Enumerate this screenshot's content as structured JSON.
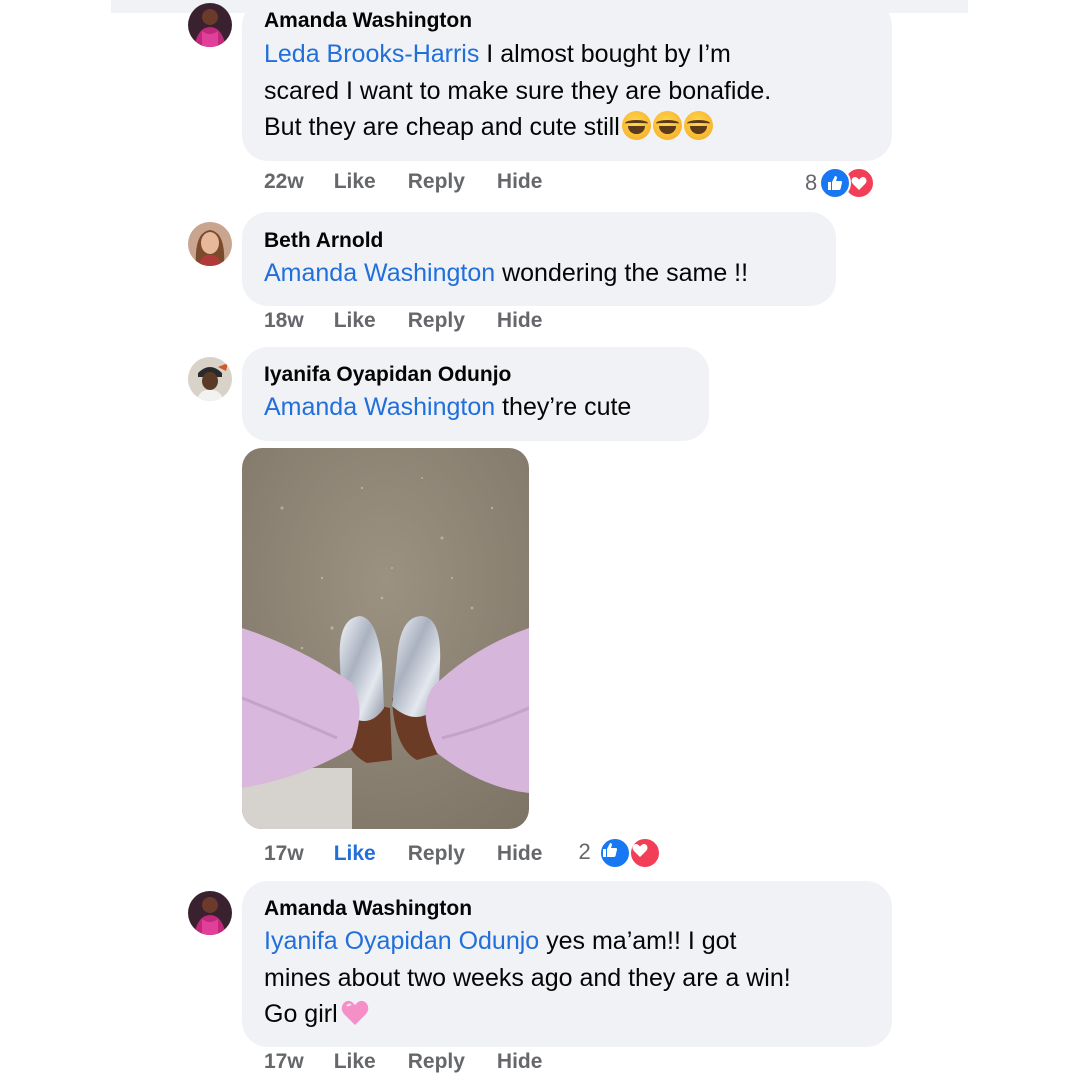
{
  "comments": [
    {
      "author": "Amanda Washington",
      "mention": "Leda Brooks-Harris",
      "lines": [
        " I almost bought by I’m",
        "scared I want to make sure they are bonafide.",
        "But they are cheap and cute still"
      ],
      "emoji": [
        "laughing-tears",
        "laughing-tears",
        "laughing-tears"
      ],
      "time": "22w",
      "like_label": "Like",
      "reply_label": "Reply",
      "hide_label": "Hide",
      "reaction_count": "8",
      "reactions": [
        "like",
        "love"
      ]
    },
    {
      "author": "Beth Arnold",
      "mention": "Amanda Washington",
      "text": " wondering the same !!",
      "time": "18w",
      "like_label": "Like",
      "reply_label": "Reply",
      "hide_label": "Hide"
    },
    {
      "author": "Iyanifa Oyapidan Odunjo",
      "mention": "Amanda Washington",
      "text": " they’re cute",
      "has_photo": true,
      "time": "17w",
      "like_label": "Like",
      "like_active": true,
      "reply_label": "Reply",
      "hide_label": "Hide",
      "reaction_count": "2",
      "reactions": [
        "like",
        "love"
      ]
    },
    {
      "author": "Amanda Washington",
      "mention": "Iyanifa Oyapidan Odunjo",
      "lines": [
        " yes ma’am!! I got",
        "mines about two weeks ago and they are a win!",
        "Go girl"
      ],
      "emoji": [
        "pink-heart"
      ],
      "time": "17w",
      "like_label": "Like",
      "reply_label": "Reply",
      "hide_label": "Hide"
    }
  ],
  "colors": {
    "mention": "#216fdb",
    "bubble": "#f0f2f5",
    "meta": "#65676b",
    "like_active": "#216fdb",
    "reaction_like": "#1877f2",
    "reaction_love": "#f33e58"
  }
}
